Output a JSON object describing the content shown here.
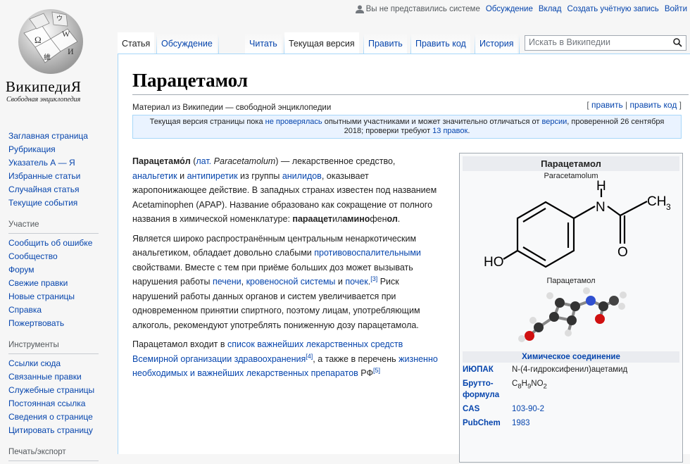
{
  "personal": {
    "not_logged": "Вы не представились системе",
    "talk": "Обсуждение",
    "contrib": "Вклад",
    "create": "Создать учётную запись",
    "login": "Войти"
  },
  "logo": {
    "wordmark": "ВикипедиЯ",
    "tagline": "Свободная энциклопедия"
  },
  "sidebar": {
    "nav": [
      "Заглавная страница",
      "Рубрикация",
      "Указатель А — Я",
      "Избранные статьи",
      "Случайная статья",
      "Текущие события"
    ],
    "participation_heading": "Участие",
    "participation": [
      "Сообщить об ошибке",
      "Сообщество",
      "Форум",
      "Свежие правки",
      "Новые страницы",
      "Справка",
      "Пожертвовать"
    ],
    "tools_heading": "Инструменты",
    "tools": [
      "Ссылки сюда",
      "Связанные правки",
      "Служебные страницы",
      "Постоянная ссылка",
      "Сведения о странице",
      "Цитировать страницу"
    ],
    "print_heading": "Печать/экспорт"
  },
  "tabs": {
    "article": "Статья",
    "talk": "Обсуждение",
    "read": "Читать",
    "current": "Текущая версия",
    "edit": "Править",
    "edit_code": "Править код",
    "history": "История"
  },
  "search": {
    "placeholder": "Искать в Википедии"
  },
  "page": {
    "title": "Парацетамол",
    "sitesub": "Материал из Википедии — свободной энциклопедии",
    "edit_open": "[ ",
    "edit": "править",
    "edit_sep": " | ",
    "edit_code": "править код",
    "edit_close": " ]",
    "notice_a": "Текущая версия страницы пока ",
    "notice_link1": "не проверялась",
    "notice_b": " опытными участниками и может значительно отличаться от ",
    "notice_link2": "версии",
    "notice_c": ", проверенной 26 сентября 2018; проверки требуют ",
    "notice_link3": "13 правок",
    "notice_d": "."
  },
  "body": {
    "p1": {
      "bold1": "Парацетамо́л",
      "t1": " (",
      "lat": "лат.",
      "t2": " ",
      "latname": "Paracetamolum",
      "t3": ") — лекарственное средство, ",
      "l1": "анальгетик",
      "t4": " и ",
      "l2": "антипиретик",
      "t5": " из группы ",
      "l3": "анилидов",
      "t6": ", оказывает жаропонижающее действие. В западных странах известен под названием Acetaminophen (APAP). Название образовано как сокращение от полного названия в химической номенклатуре: ",
      "b2": "параацет",
      "t7": "ил",
      "b3": "амино",
      "t8": "фен",
      "b4": "ол",
      "t9": "."
    },
    "p2": {
      "t1": "Является широко распространённым центральным ненаркотическим анальгетиком, обладает довольно слабыми ",
      "l1": "противовоспалительными",
      "t2": " свойствами. Вместе с тем при приёме больших доз может вызывать нарушения работы ",
      "l2": "печени",
      "t3": ", ",
      "l3": "кровеносной системы",
      "t4": " и ",
      "l4": "почек",
      "t5": ".",
      "ref": "[3]",
      "t6": " Риск нарушений работы данных органов и систем увеличивается при одновременном принятии спиртного, поэтому лицам, употребляющим алкоголь, рекомендуют употреблять пониженную дозу парацетамола."
    },
    "p3": {
      "t1": "Парацетамол входит в ",
      "l1": "список важнейших лекарственных средств Всемирной организации здравоохранения",
      "ref1": "[4]",
      "t2": ", а также в перечень ",
      "l2": "жизненно необходимых и важнейших лекарственных препаратов",
      "t3": " РФ",
      "ref2": "[5]"
    }
  },
  "infobox": {
    "title": "Парацетамол",
    "latin": "Paracetamolum",
    "formula_labels": {
      "n": "N",
      "h": "H",
      "ch3": "CH",
      "ch3sub": "3",
      "o": "O",
      "ho": "HO"
    },
    "caption": "Парацетамол",
    "subhead": "Химическое соединение",
    "rows": [
      {
        "k": "ИЮПАК",
        "v": "N-(4-гидроксифенил)ацетамид"
      },
      {
        "k": "Брутто-формула",
        "v": "C8H9NO2"
      },
      {
        "k": "CAS",
        "v": "103-90-2"
      },
      {
        "k": "PubChem",
        "v": "1983"
      }
    ],
    "brutto_parts": [
      "C",
      "8",
      "H",
      "9",
      "NO",
      "2"
    ]
  },
  "colors": {
    "link": "#0645ad",
    "border": "#a7d7f9",
    "notice_bg": "#eaf3ff"
  }
}
